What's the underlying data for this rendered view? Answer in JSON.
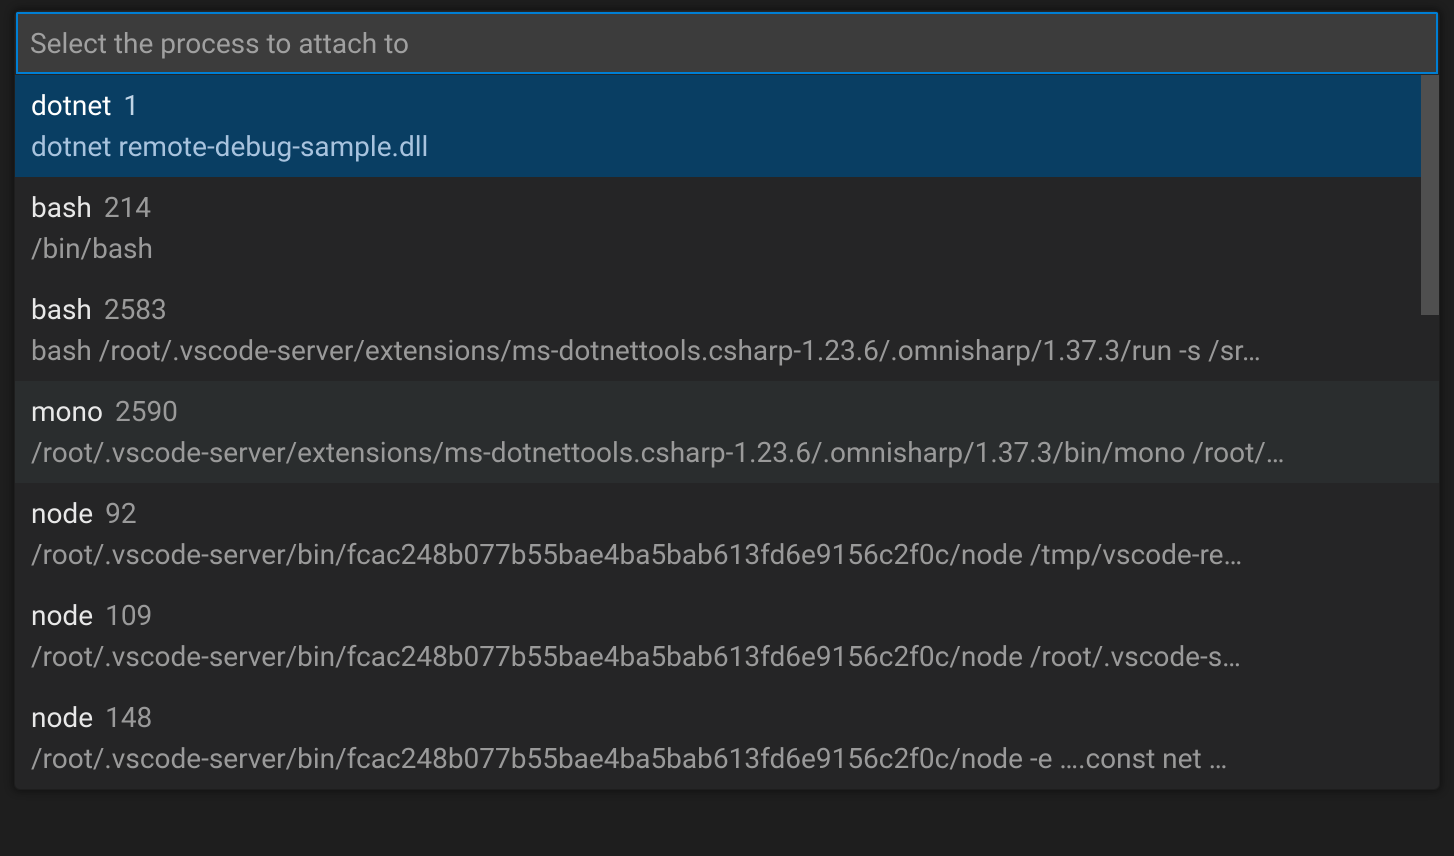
{
  "search": {
    "placeholder": "Select the process to attach to",
    "value": ""
  },
  "processes": [
    {
      "name": "dotnet",
      "pid": "1",
      "detail": "dotnet remote-debug-sample.dll",
      "selected": true,
      "hover": false
    },
    {
      "name": "bash",
      "pid": "214",
      "detail": "/bin/bash",
      "selected": false,
      "hover": false
    },
    {
      "name": "bash",
      "pid": "2583",
      "detail": "bash /root/.vscode-server/extensions/ms-dotnettools.csharp-1.23.6/.omnisharp/1.37.3/run -s /sr…",
      "selected": false,
      "hover": false
    },
    {
      "name": "mono",
      "pid": "2590",
      "detail": "/root/.vscode-server/extensions/ms-dotnettools.csharp-1.23.6/.omnisharp/1.37.3/bin/mono /root/…",
      "selected": false,
      "hover": true
    },
    {
      "name": "node",
      "pid": "92",
      "detail": "/root/.vscode-server/bin/fcac248b077b55bae4ba5bab613fd6e9156c2f0c/node /tmp/vscode-re…",
      "selected": false,
      "hover": false
    },
    {
      "name": "node",
      "pid": "109",
      "detail": "/root/.vscode-server/bin/fcac248b077b55bae4ba5bab613fd6e9156c2f0c/node /root/.vscode-s…",
      "selected": false,
      "hover": false
    },
    {
      "name": "node",
      "pid": "148",
      "detail": "/root/.vscode-server/bin/fcac248b077b55bae4ba5bab613fd6e9156c2f0c/node -e ….const net …",
      "selected": false,
      "hover": false
    }
  ]
}
